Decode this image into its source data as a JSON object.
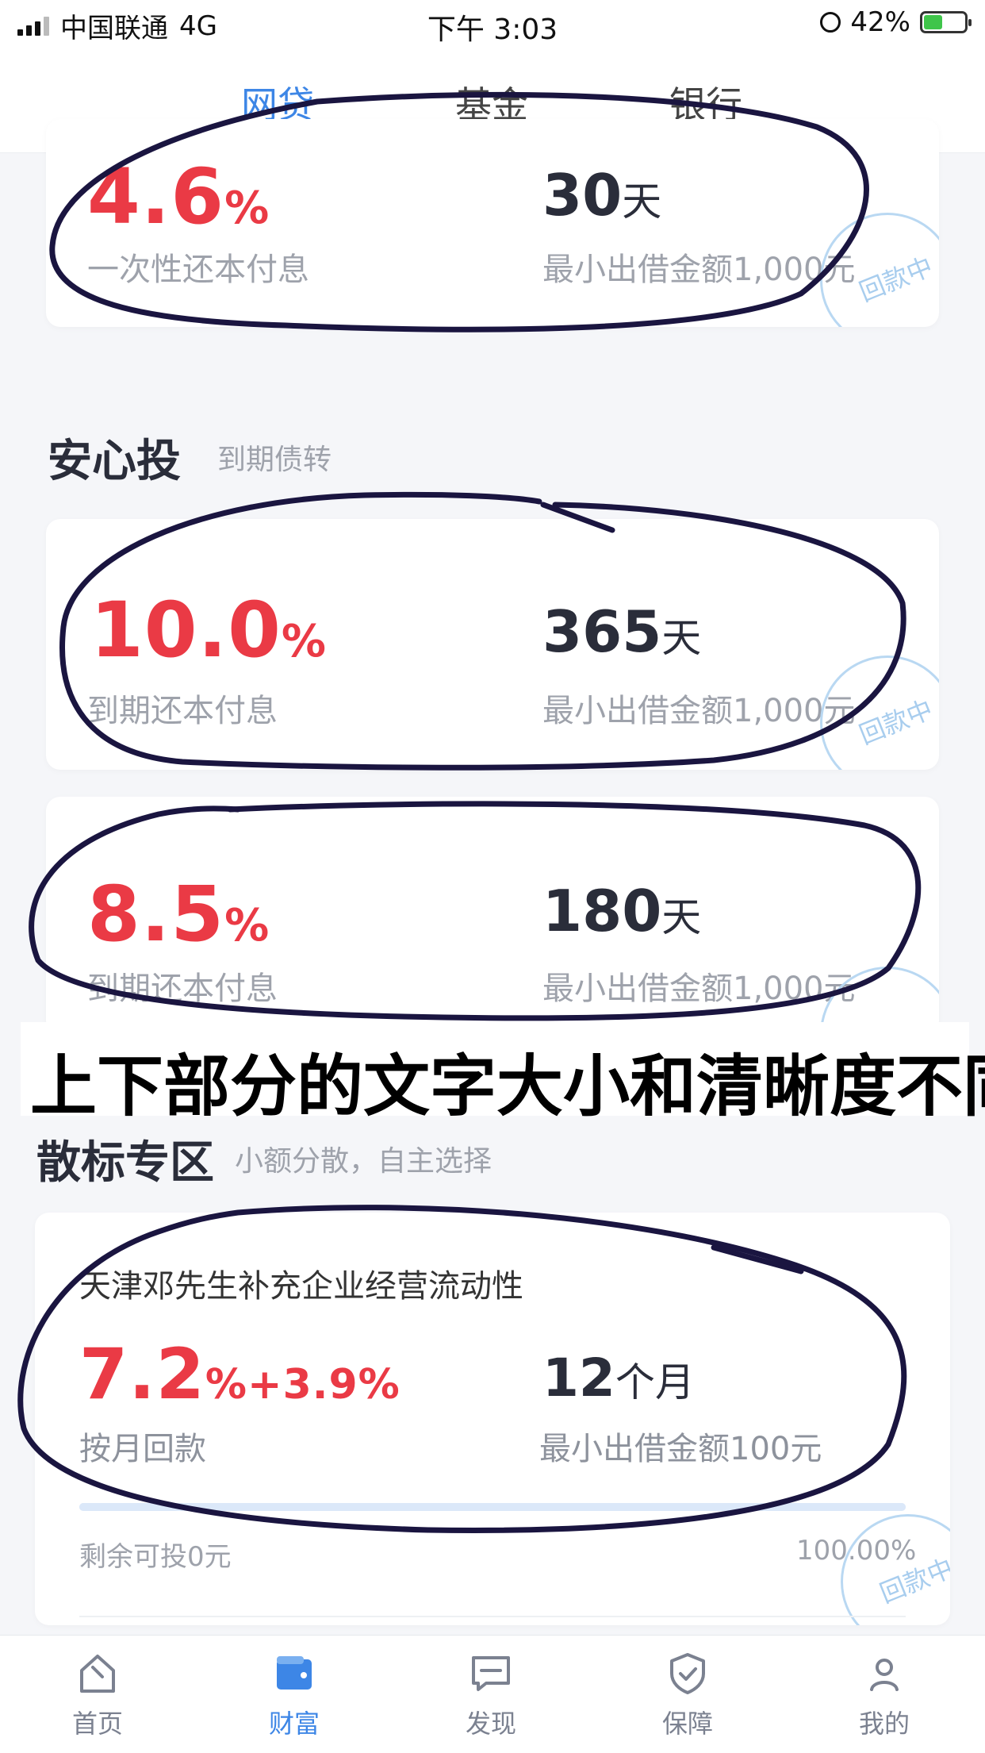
{
  "status_bar": {
    "carrier": "中国联通",
    "network": "4G",
    "time": "下午 3:03",
    "battery": "42%",
    "battery_level": 0.42
  },
  "tabs": [
    {
      "label": "网贷",
      "active": true
    },
    {
      "label": "基金"
    },
    {
      "label": "银行"
    }
  ],
  "top_card": {
    "rate": "4.6",
    "rate_unit": "%",
    "repay": "一次性还本付息",
    "term": "30",
    "term_unit": "天",
    "min_amount": "最小出借金额1,000元",
    "stamp": "回款中"
  },
  "section_anxin": {
    "title": "安心投",
    "subtitle": "到期债转"
  },
  "anxin_cards": [
    {
      "rate": "10.0",
      "rate_unit": "%",
      "repay": "到期还本付息",
      "term": "365",
      "term_unit": "天",
      "min_amount": "最小出借金额1,000元",
      "stamp": "回款中"
    },
    {
      "rate": "8.5",
      "rate_unit": "%",
      "repay": "到期还本付息",
      "term": "180",
      "term_unit": "天",
      "min_amount": "最小出借金额1,000元"
    }
  ],
  "annotation": "上下部分的文字大小和清晰度不同",
  "section_sanbiao": {
    "title": "散标专区",
    "subtitle": "小额分散，自主选择"
  },
  "loan_card": {
    "title": "天津邓先生补充企业经营流动性",
    "rate": "7.2",
    "rate_extra": "%+3.9%",
    "repay": "按月回款",
    "term": "12",
    "term_unit": "个月",
    "min_amount": "最小出借金额100元",
    "remaining": "剩余可投0元",
    "progress_text": "100.00%",
    "progress": 1.0,
    "stamp": "回款中"
  },
  "bottom_nav": [
    {
      "label": "首页",
      "icon": "home-icon"
    },
    {
      "label": "财富",
      "icon": "wallet-icon",
      "active": true
    },
    {
      "label": "发现",
      "icon": "chat-icon"
    },
    {
      "label": "保障",
      "icon": "shield-icon"
    },
    {
      "label": "我的",
      "icon": "user-icon"
    }
  ],
  "colors": {
    "accent": "#3d86e6",
    "rate_red": "#ea3a45",
    "ink": "#1a1540"
  }
}
